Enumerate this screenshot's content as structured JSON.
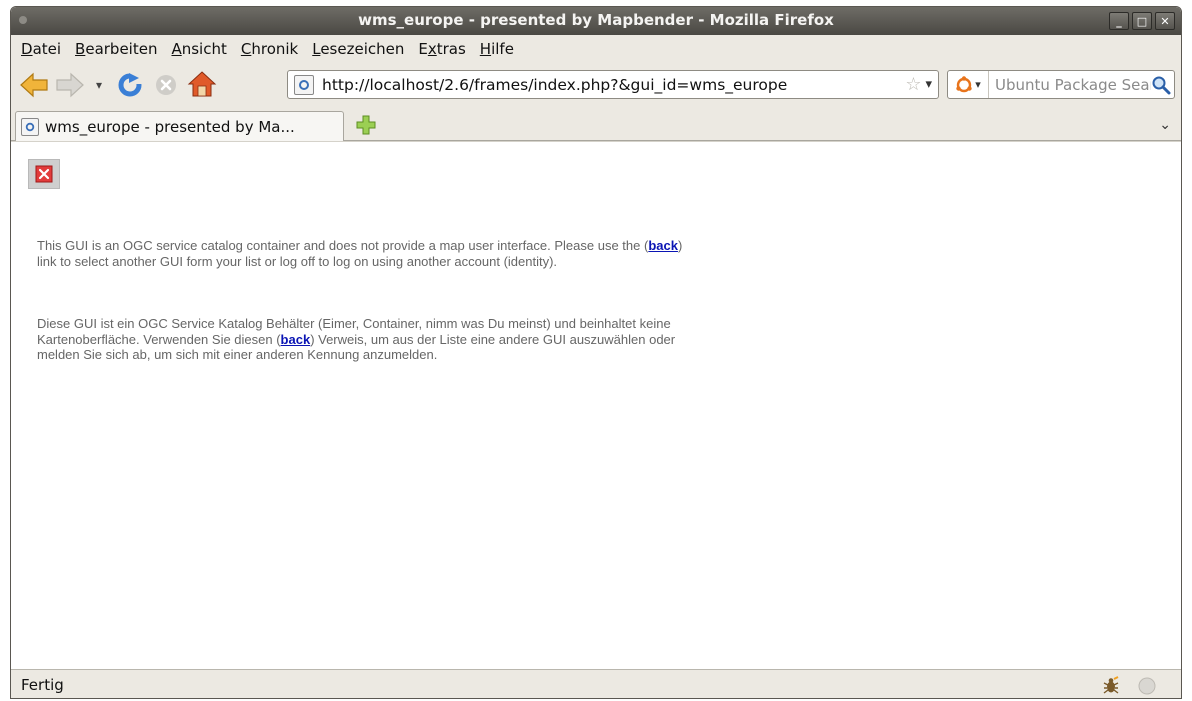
{
  "window": {
    "title": "wms_europe - presented by Mapbender - Mozilla Firefox",
    "controls": [
      "minimize-icon",
      "maximize-icon",
      "close-icon"
    ]
  },
  "menubar": {
    "items": [
      {
        "label": "Datei",
        "mnemonic": "D"
      },
      {
        "label": "Bearbeiten",
        "mnemonic": "B"
      },
      {
        "label": "Ansicht",
        "mnemonic": "A"
      },
      {
        "label": "Chronik",
        "mnemonic": "C"
      },
      {
        "label": "Lesezeichen",
        "mnemonic": "L"
      },
      {
        "label": "Extras",
        "mnemonic": "x"
      },
      {
        "label": "Hilfe",
        "mnemonic": "H"
      }
    ]
  },
  "navbar": {
    "back_icon": "arrow-left-icon",
    "forward_icon": "arrow-right-icon",
    "reload_icon": "reload-icon",
    "stop_icon": "stop-icon",
    "home_icon": "home-icon",
    "url": "http://localhost/2.6/frames/index.php?&gui_id=wms_europe",
    "search_placeholder": "Ubuntu Package Search"
  },
  "tabs": [
    {
      "label": "wms_europe - presented by Ma...",
      "active": true
    }
  ],
  "content": {
    "para_en_1": "This GUI is an OGC service catalog container and does not provide a map user interface. Please use the (",
    "para_en_link": "back",
    "para_en_2": ") link to select another GUI form your list or log off to log on using another account (identity).",
    "para_de_1": "Diese GUI ist ein OGC Service Katalog Behälter (Eimer, Container, nimm was Du meinst) und beinhaltet keine Kartenoberfläche. Verwenden Sie diesen (",
    "para_de_link": "back",
    "para_de_2": ") Verweis, um aus der Liste eine andere GUI auszuwählen oder melden Sie sich ab, um sich mit einer anderen Kennung anzumelden."
  },
  "status": {
    "text": "Fertig"
  },
  "colors": {
    "titlebar": "#4a4843",
    "chrome": "#ece9e2",
    "link": "#0a14b4",
    "body_text": "#666666"
  }
}
